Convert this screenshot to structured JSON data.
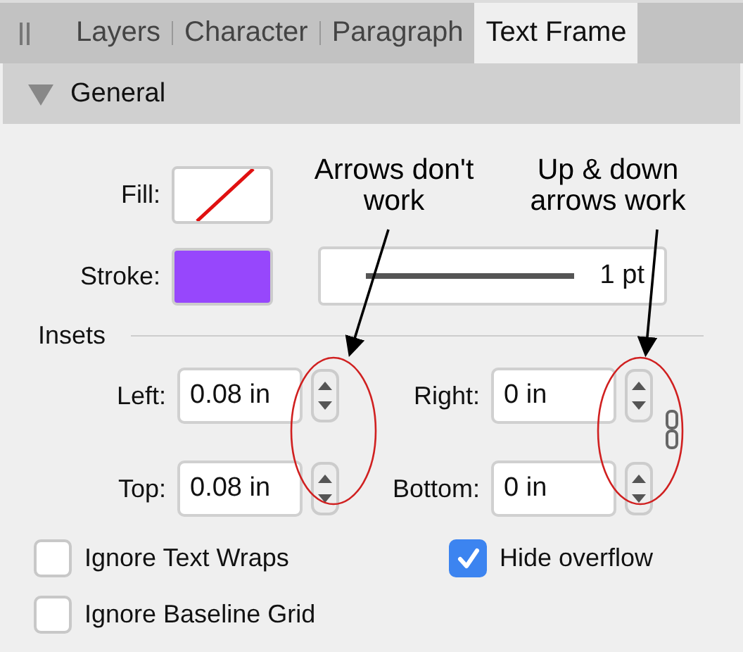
{
  "tabs": [
    {
      "label": "Layers",
      "selected": false
    },
    {
      "label": "Character",
      "selected": false
    },
    {
      "label": "Paragraph",
      "selected": false
    },
    {
      "label": "Text Frame",
      "selected": true
    }
  ],
  "section": {
    "title": "General",
    "expanded": true
  },
  "fill": {
    "label": "Fill:",
    "kind": "none"
  },
  "stroke": {
    "label": "Stroke:",
    "color": "#9747fc",
    "weight": "1 pt"
  },
  "insets": {
    "label": "Insets",
    "linked": true,
    "fields": [
      {
        "label": "Left:",
        "value": "0.08 in"
      },
      {
        "label": "Right:",
        "value": "0 in"
      },
      {
        "label": "Top:",
        "value": "0.08 in"
      },
      {
        "label": "Bottom:",
        "value": "0 in"
      }
    ]
  },
  "checkboxes": [
    {
      "label": "Ignore Text Wraps",
      "checked": false
    },
    {
      "label": "Hide overflow",
      "checked": true
    },
    {
      "label": "Ignore Baseline Grid",
      "checked": false
    }
  ],
  "annotations": [
    {
      "text": "Arrows don't work"
    },
    {
      "text": "Up & down arrows work"
    }
  ]
}
